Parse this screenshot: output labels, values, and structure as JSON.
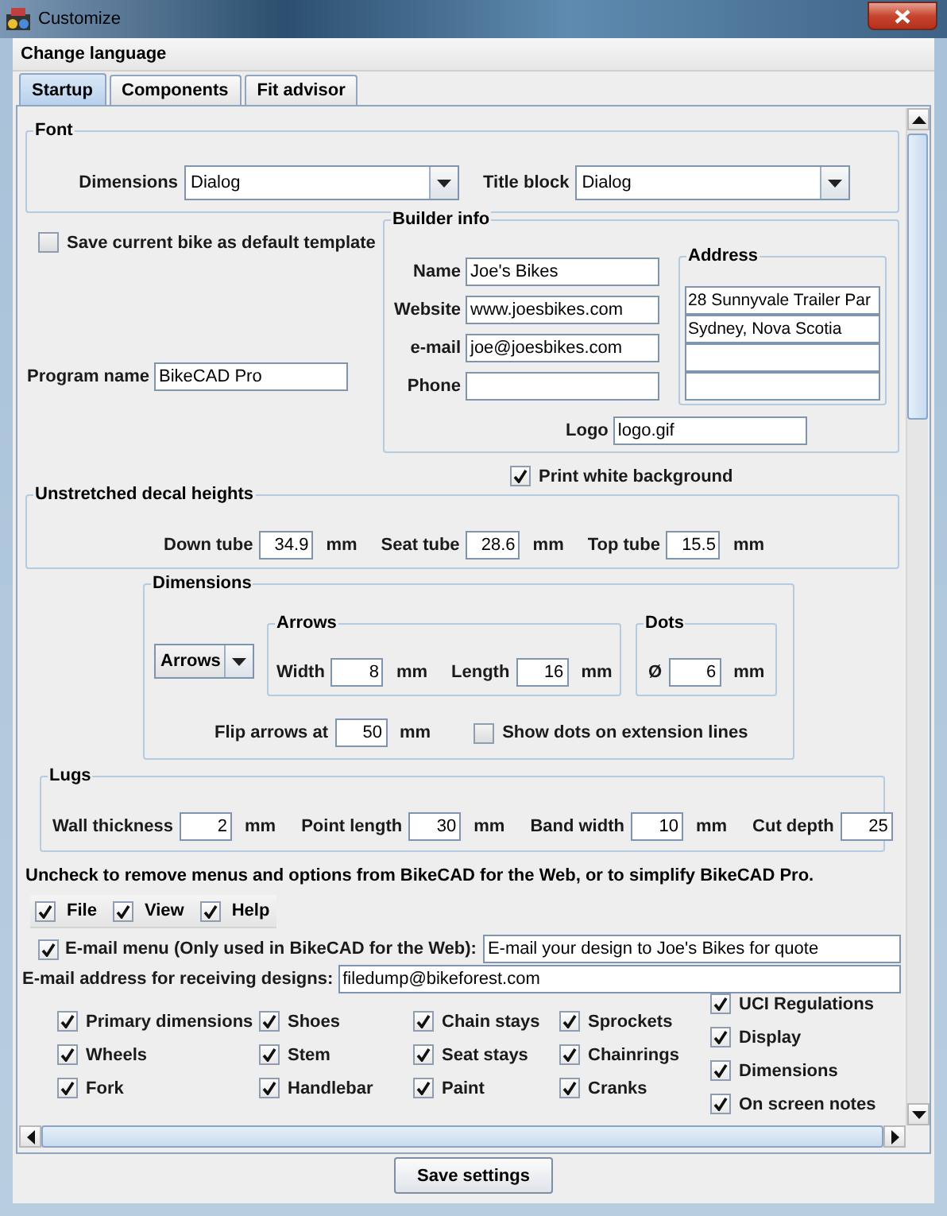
{
  "window": {
    "title": "Customize"
  },
  "menu_bar": [
    "Change language"
  ],
  "tabs": [
    {
      "label": "Startup",
      "selected": true
    },
    {
      "label": "Components",
      "selected": false
    },
    {
      "label": "Fit advisor",
      "selected": false
    }
  ],
  "font_group": {
    "title": "Font",
    "fields": [
      {
        "label": "Dimensions",
        "value": "Dialog"
      },
      {
        "label": "Title block",
        "value": "Dialog"
      }
    ]
  },
  "save_default": {
    "label": "Save current bike as default template",
    "checked": false
  },
  "program_name": {
    "label": "Program name",
    "value": "BikeCAD Pro"
  },
  "builder_info": {
    "title": "Builder info",
    "fields": [
      {
        "label": "Name",
        "value": "Joe's Bikes"
      },
      {
        "label": "Website",
        "value": "www.joesbikes.com"
      },
      {
        "label": "e-mail",
        "value": "joe@joesbikes.com"
      },
      {
        "label": "Phone"
      }
    ],
    "address": {
      "title": "Address",
      "lines": [
        {
          "kind": "text",
          "value": "28 Sunnyvale Trailer Par"
        },
        {
          "kind": "text",
          "value": "Sydney, Nova Scotia"
        },
        {
          "kind": "blank"
        },
        {
          "kind": "blank"
        }
      ]
    },
    "logo": {
      "label": "Logo",
      "value": "logo.gif"
    }
  },
  "print_white": {
    "label": "Print white background",
    "checked": true
  },
  "decal_heights": {
    "title": "Unstretched decal heights",
    "fields": [
      {
        "label": "Down tube",
        "value": "34.9",
        "unit": "mm"
      },
      {
        "label": "Seat tube",
        "value": "28.6",
        "unit": "mm"
      },
      {
        "label": "Top tube",
        "value": "15.5",
        "unit": "mm"
      }
    ]
  },
  "dimensions": {
    "title": "Dimensions",
    "style": "Arrows",
    "arrows": {
      "title": "Arrows",
      "fields": [
        {
          "label": "Width",
          "value": "8",
          "unit": "mm"
        },
        {
          "label": "Length",
          "value": "16",
          "unit": "mm"
        }
      ]
    },
    "dots": {
      "title": "Dots",
      "fields": [
        {
          "label": "Ø",
          "value": "6",
          "unit": "mm"
        }
      ]
    },
    "flip": {
      "label": "Flip arrows at",
      "value": "50",
      "unit": "mm"
    },
    "show_dots": {
      "label": "Show dots on extension lines",
      "checked": false
    }
  },
  "lugs": {
    "title": "Lugs",
    "fields": [
      {
        "label": "Wall thickness",
        "value": "2",
        "unit": "mm"
      },
      {
        "label": "Point length",
        "value": "30",
        "unit": "mm"
      },
      {
        "label": "Band width",
        "value": "10",
        "unit": "mm"
      },
      {
        "label": "Cut depth",
        "value": "25"
      }
    ]
  },
  "menus_note": "Uncheck to remove menus and options from BikeCAD for the Web, or to simplify BikeCAD Pro.",
  "menu_toggles": [
    {
      "label": "File",
      "checked": true
    },
    {
      "label": "View",
      "checked": true
    },
    {
      "label": "Help",
      "checked": true
    }
  ],
  "email_menu": {
    "label": "E-mail menu (Only used in BikeCAD for the Web):",
    "checked": true,
    "value": "E-mail your design to Joe's Bikes for quote"
  },
  "email_address": {
    "label": "E-mail address for receiving designs:",
    "value": "filedump@bikeforest.com"
  },
  "option_columns": [
    [
      {
        "label": "Primary dimensions",
        "checked": true
      },
      {
        "label": "Wheels",
        "checked": true
      },
      {
        "label": "Fork",
        "checked": true
      }
    ],
    [
      {
        "label": "Shoes",
        "checked": true
      },
      {
        "label": "Stem",
        "checked": true
      },
      {
        "label": "Handlebar",
        "checked": true
      }
    ],
    [
      {
        "label": "Chain stays",
        "checked": true
      },
      {
        "label": "Seat stays",
        "checked": true
      },
      {
        "label": "Paint",
        "checked": true
      }
    ],
    [
      {
        "label": "Sprockets",
        "checked": true
      },
      {
        "label": "Chainrings",
        "checked": true
      },
      {
        "label": "Cranks",
        "checked": true
      }
    ],
    [
      {
        "label": "UCI Regulations",
        "checked": true
      },
      {
        "label": "Display",
        "checked": true
      },
      {
        "label": "Dimensions",
        "checked": true
      },
      {
        "label": "On screen notes",
        "checked": true
      }
    ]
  ],
  "save_button": "Save settings"
}
